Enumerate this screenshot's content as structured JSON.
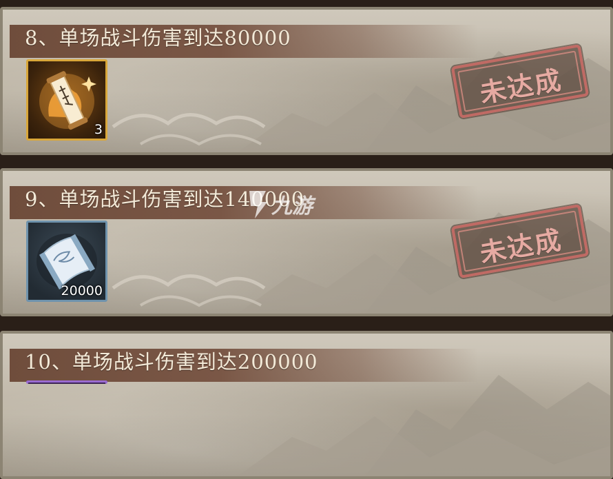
{
  "tasks": [
    {
      "title": "8、单场战斗伤害到达80000",
      "reward_qty": "3",
      "status": "未达成"
    },
    {
      "title": "9、单场战斗伤害到达140000",
      "reward_qty": "20000",
      "status": "未达成"
    },
    {
      "title": "10、单场战斗伤害到达200000"
    }
  ],
  "watermark": {
    "text": "九游",
    "icon": "nine-game-logo-icon"
  },
  "colors": {
    "frame": "#8c8473",
    "title_bar": "#6f4d3c",
    "stamp_border": "#c06a64",
    "stamp_text": "#e6aaa2",
    "item_gold": "#d9a73a",
    "item_blue": "#6f93ad",
    "item_purple": "#9a6bd1"
  }
}
